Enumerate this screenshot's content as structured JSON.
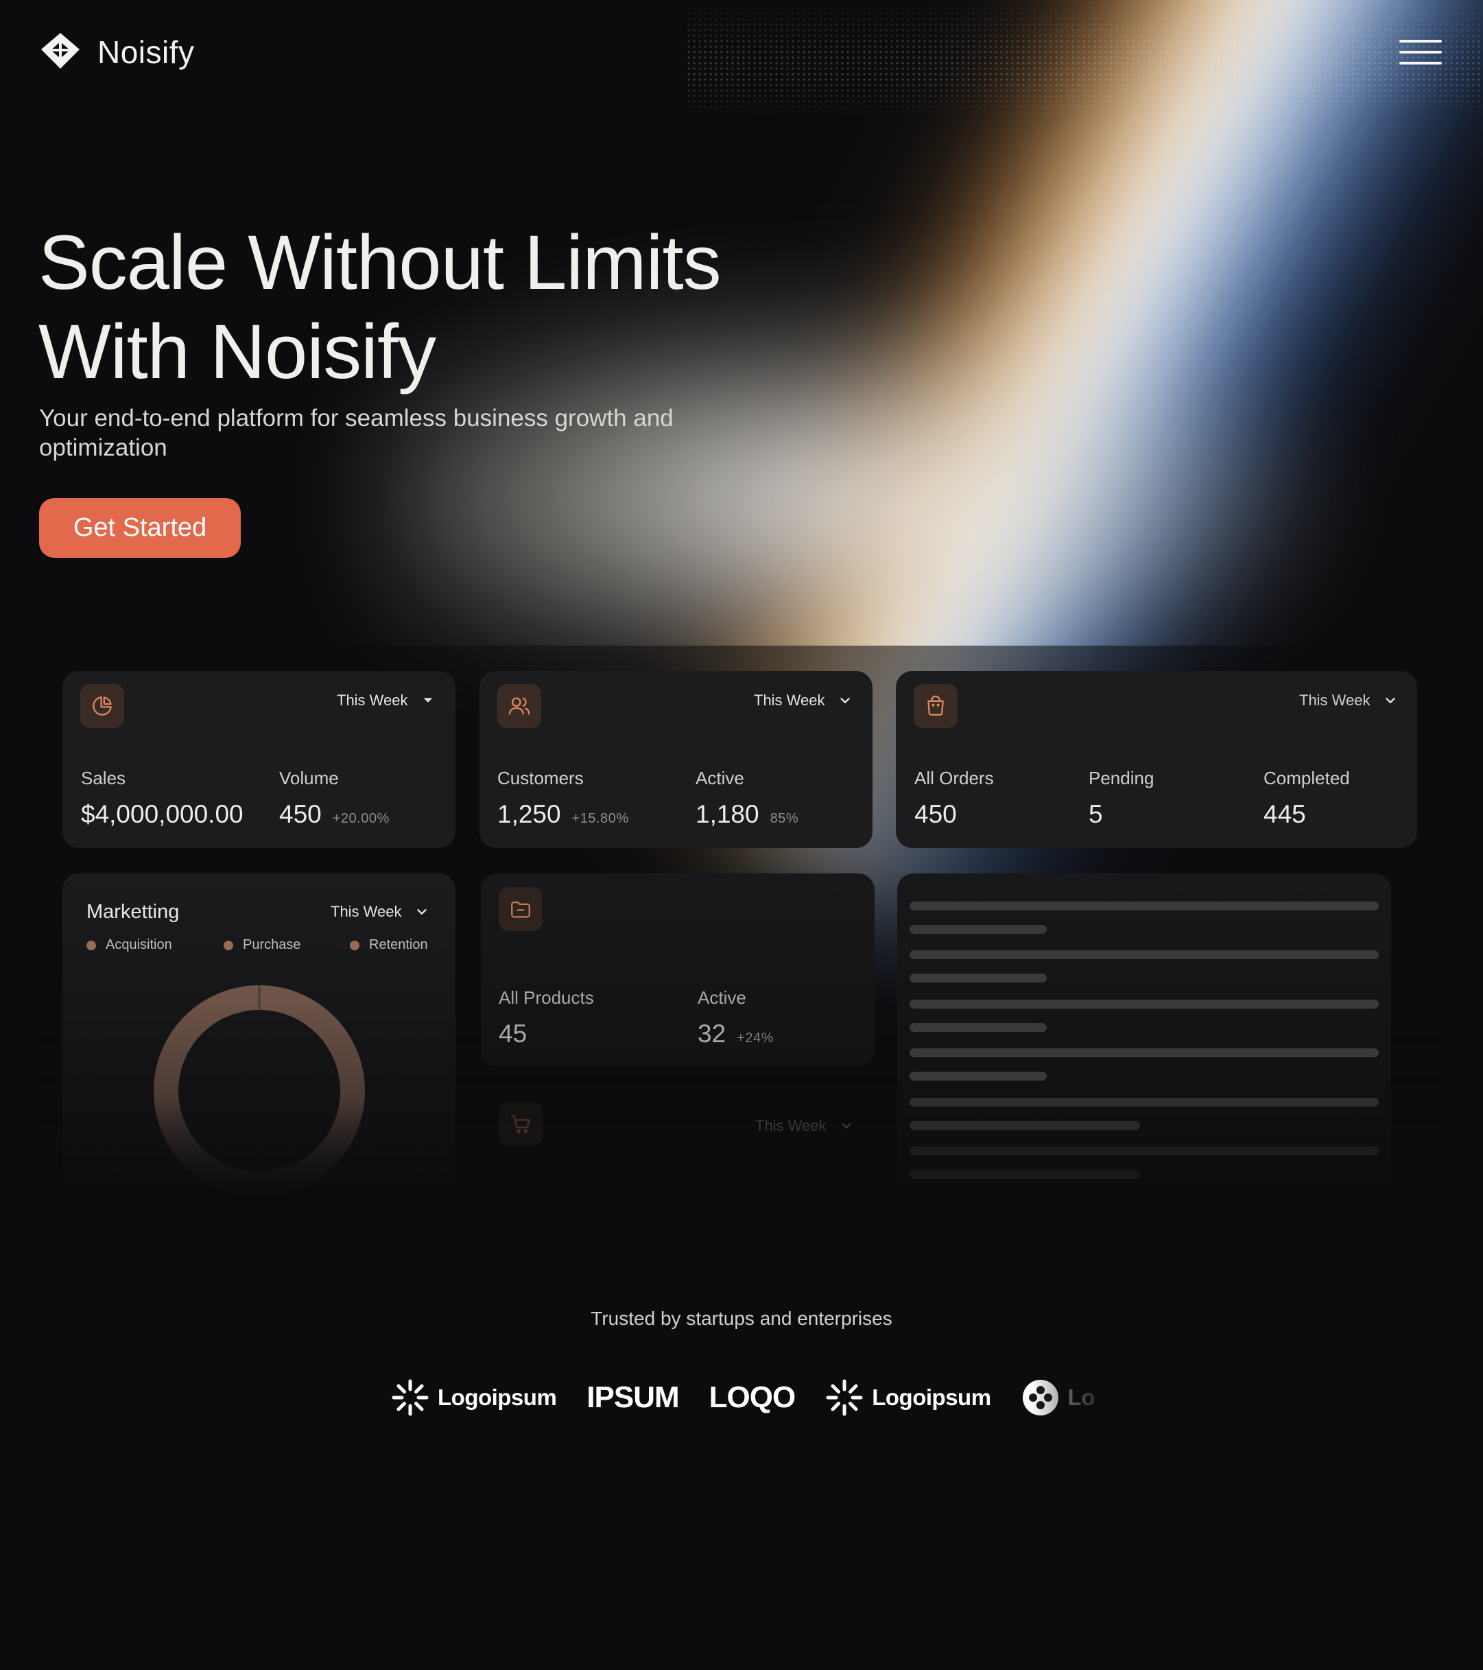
{
  "nav": {
    "brand": "Noisify",
    "logo_icon": "diamond-cube-icon",
    "menu_icon": "hamburger-menu-icon"
  },
  "hero": {
    "title_line1": "Scale Without Limits",
    "title_line2": "With Noisify",
    "subtitle": "Your end-to-end platform for seamless business growth and optimization",
    "cta_label": "Get Started"
  },
  "colors": {
    "accent": "#e2694c",
    "background": "#0c0c0e",
    "card": "#1c1c1e",
    "icon_tile": "#3a2c25",
    "icon_stroke": "#e0895e"
  },
  "dashboard": {
    "sales": {
      "icon": "pie-chart-icon",
      "period": "This Week",
      "label_a": "Sales",
      "value_a": "$4,000,000.00",
      "label_b": "Volume",
      "value_b": "450",
      "delta_b": "+20.00%"
    },
    "customers": {
      "icon": "users-icon",
      "period": "This Week",
      "label_a": "Customers",
      "value_a": "1,250",
      "delta_a": "+15.80%",
      "label_b": "Active",
      "value_b": "1,180",
      "delta_b": "85%"
    },
    "orders": {
      "icon": "shopping-bag-icon",
      "period": "This Week",
      "label_a": "All Orders",
      "value_a": "450",
      "label_b": "Pending",
      "value_b": "5",
      "label_c": "Completed",
      "value_c": "445"
    },
    "marketing": {
      "title": "Marketting",
      "period": "This Week",
      "legend": [
        "Acquisition",
        "Purchase",
        "Retention"
      ]
    },
    "products": {
      "icon": "folder-icon",
      "label_a": "All Products",
      "value_a": "45",
      "label_b": "Active",
      "value_b": "32",
      "delta_b": "+24%"
    },
    "cart": {
      "icon": "shopping-cart-icon",
      "period": "This Week"
    }
  },
  "trusted": {
    "heading": "Trusted by startups and enterprises",
    "logos": [
      "Logoipsum",
      "IPSUM",
      "LOQO",
      "Logoipsum",
      "Lo"
    ]
  }
}
